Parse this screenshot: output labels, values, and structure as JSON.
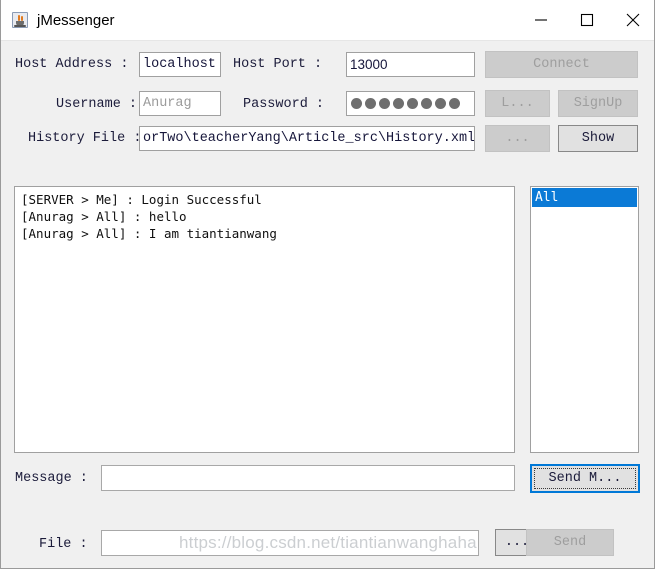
{
  "window": {
    "title": "jMessenger",
    "app_icon": "java-coffee-cup-icon",
    "controls": {
      "minimize": "minimize-icon",
      "maximize": "maximize-icon",
      "close": "close-icon"
    }
  },
  "form": {
    "host_address": {
      "label": "Host Address :",
      "value": "localhost"
    },
    "host_port": {
      "label": "Host Port :",
      "value": "13000"
    },
    "connect_button": {
      "label": "Connect",
      "enabled": false
    },
    "username": {
      "label": "Username :",
      "value": "Anurag"
    },
    "password": {
      "label": "Password :",
      "masked_char_count": 8,
      "value": "••••••••"
    },
    "login_button": {
      "label": "L...",
      "enabled": false
    },
    "signup_button": {
      "label": "SignUp",
      "enabled": false
    },
    "history_file": {
      "label": "History File :",
      "value": "orTwo\\teacherYang\\Article_src\\History.xml"
    },
    "history_browse_button": {
      "label": "...",
      "enabled": false
    },
    "show_button": {
      "label": "Show",
      "enabled": true
    }
  },
  "chat": {
    "messages": [
      "[SERVER > Me] : Login Successful",
      "[Anurag > All] : hello",
      "[Anurag > All] : I am tiantianwang"
    ]
  },
  "user_list": {
    "items": [
      {
        "label": "All",
        "selected": true
      }
    ],
    "selection_color": "#0b7ad6"
  },
  "message_row": {
    "label": "Message :",
    "value": "",
    "send_button": {
      "label": "Send M...",
      "focused": true
    }
  },
  "file_row": {
    "label": "File :",
    "value": "",
    "browse_button": {
      "label": "...",
      "enabled": true
    },
    "send_button": {
      "label": "Send",
      "enabled": false
    }
  },
  "watermark": {
    "text": "https://blog.csdn.net/tiantianwanghaha"
  }
}
